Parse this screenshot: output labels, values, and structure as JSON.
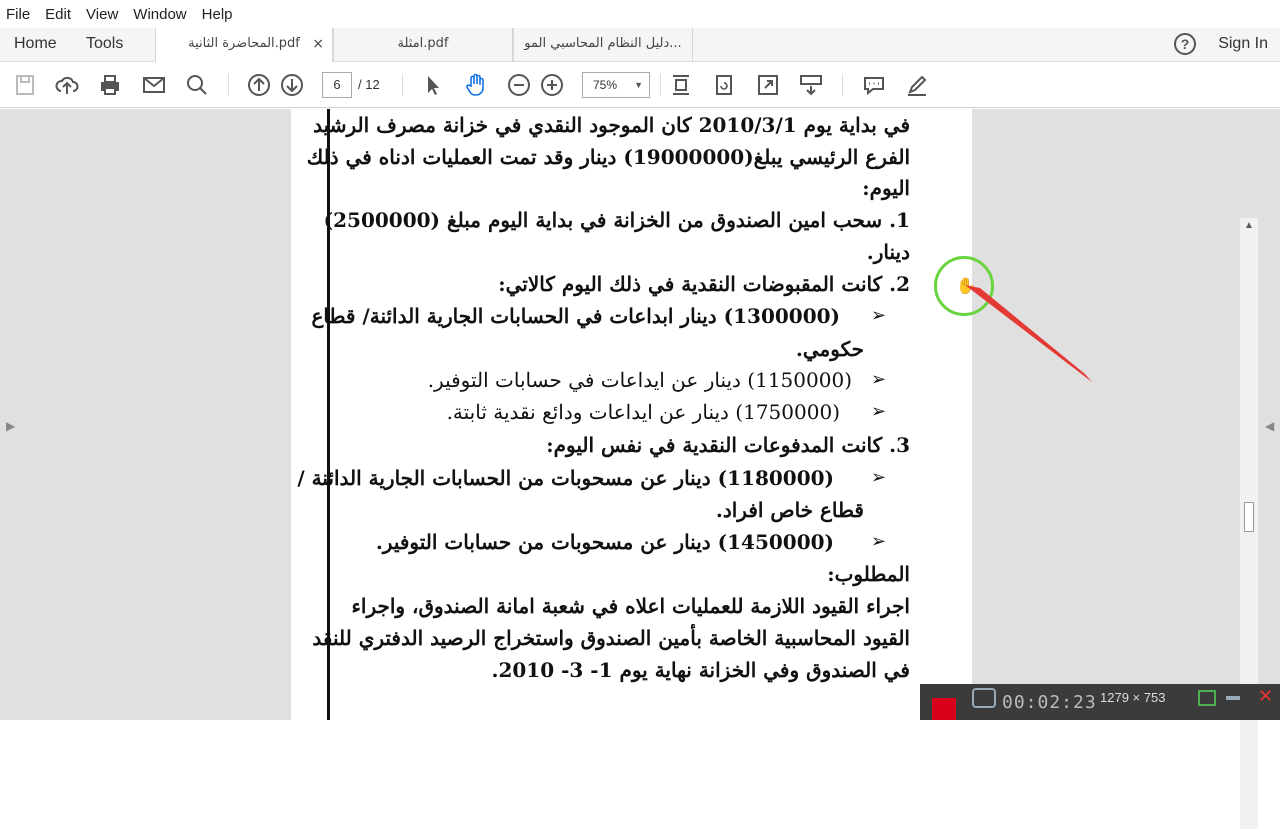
{
  "menu": [
    "File",
    "Edit",
    "View",
    "Window",
    "Help"
  ],
  "nav": {
    "home": "Home",
    "tools": "Tools"
  },
  "tabs": [
    {
      "label": "المحاضرة الثانية.pdf",
      "active": true,
      "close": "×"
    },
    {
      "label": "امثلة.pdf",
      "active": false
    },
    {
      "label": "دليل النظام المحاسبي المو...",
      "active": false
    }
  ],
  "help_icon": "?",
  "signin": "Sign In",
  "toolbar": {
    "page_current": "6",
    "page_total": "/ 12",
    "zoom": "75%",
    "zoom_arrow": "▼"
  },
  "document": {
    "lines": [
      "في بداية يوم 2010/3/1  كان الموجود النقدي في خزانة مصرف الرشيد",
      "الفرع الرئيسي يبلغ(19000000) دينار وقد تمت العمليات ادناه في ذلك",
      "اليوم:",
      "1. سحب امين الصندوق من الخزانة في بداية اليوم مبلغ (2500000)",
      "دينار.",
      "2. كانت المقبوضات النقدية في ذلك اليوم كالاتي:",
      "(1300000) دينار ابداعات في الحسابات الجارية الدائنة/ قطاع",
      "حكومي.",
      "(1150000) دينار عن ايداعات في حسابات التوفير.",
      "(1750000) دينار عن ايداعات ودائع نقدية ثابتة.",
      "3. كانت المدفوعات النقدية في نفس اليوم:",
      "(1180000) دينار عن مسحوبات من الحسابات الجارية الدائنة /",
      "قطاع خاص افراد.",
      "(1450000) دينار عن مسحوبات من حسابات التوفير.",
      "المطلوب:",
      "اجراء القيود اللازمة للعمليات اعلاه في شعبة امانة الصندوق، واجراء",
      "القيود المحاسبية الخاصة بأمين الصندوق واستخراج الرصيد الدفتري للنقد",
      "في الصندوق وفي الخزانة نهاية يوم 1- 3- 2010."
    ],
    "bullet": "➢"
  },
  "recorder": {
    "dimensions": "1279 × 753",
    "time": "00:02:23"
  }
}
